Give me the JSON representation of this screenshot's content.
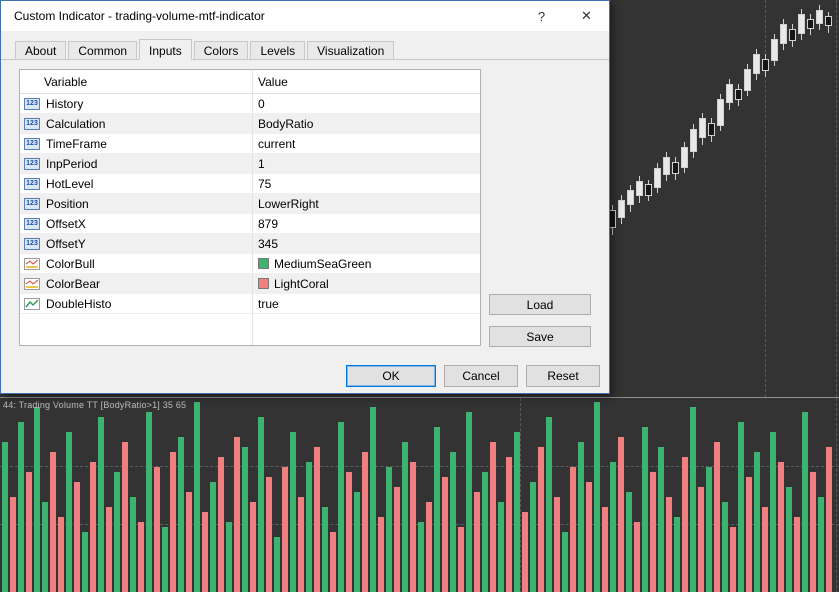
{
  "dialog": {
    "title": "Custom Indicator - trading-volume-mtf-indicator",
    "help_label": "?",
    "close_label": "✕",
    "tabs": [
      {
        "label": "About",
        "active": false
      },
      {
        "label": "Common",
        "active": false
      },
      {
        "label": "Inputs",
        "active": true
      },
      {
        "label": "Colors",
        "active": false
      },
      {
        "label": "Levels",
        "active": false
      },
      {
        "label": "Visualization",
        "active": false
      }
    ],
    "table": {
      "columns": [
        "Variable",
        "Value"
      ],
      "rows": [
        {
          "icon": "numeric-123-icon",
          "variable": "History",
          "value": "0"
        },
        {
          "icon": "numeric-123-icon",
          "variable": "Calculation",
          "value": "BodyRatio"
        },
        {
          "icon": "numeric-123-icon",
          "variable": "TimeFrame",
          "value": "current"
        },
        {
          "icon": "numeric-123-icon",
          "variable": "InpPeriod",
          "value": "1"
        },
        {
          "icon": "numeric-123-icon",
          "variable": "HotLevel",
          "value": "75"
        },
        {
          "icon": "numeric-123-icon",
          "variable": "Position",
          "value": "LowerRight"
        },
        {
          "icon": "numeric-123-icon",
          "variable": "OffsetX",
          "value": "879"
        },
        {
          "icon": "numeric-123-icon",
          "variable": "OffsetY",
          "value": "345"
        },
        {
          "icon": "color-icon",
          "variable": "ColorBull",
          "value": "MediumSeaGreen",
          "swatch": "#3CB371"
        },
        {
          "icon": "color-icon",
          "variable": "ColorBear",
          "value": "LightCoral",
          "swatch": "#F08080"
        },
        {
          "icon": "histogram-icon",
          "variable": "DoubleHisto",
          "value": "true"
        }
      ]
    },
    "buttons": {
      "load": "Load",
      "save": "Save",
      "ok": "OK",
      "cancel": "Cancel",
      "reset": "Reset"
    }
  },
  "chart": {
    "subwindow_label": "44: Trading Volume TT [BodyRatio>1]  35 65",
    "colors": {
      "bull_volume": "#3CB371",
      "bear_volume": "#F08080",
      "background": "#333333"
    }
  },
  "chart_data": {
    "type": "bar",
    "title": "Trading Volume TT [BodyRatio>1]",
    "levels": [
      35,
      65
    ],
    "bars_format": [
      "height_px",
      "color g=MediumSeaGreen p=LightCoral"
    ],
    "bars": [
      [
        150,
        "g"
      ],
      [
        95,
        "p"
      ],
      [
        170,
        "g"
      ],
      [
        120,
        "p"
      ],
      [
        185,
        "g"
      ],
      [
        90,
        "g"
      ],
      [
        140,
        "p"
      ],
      [
        75,
        "p"
      ],
      [
        160,
        "g"
      ],
      [
        110,
        "p"
      ],
      [
        60,
        "g"
      ],
      [
        130,
        "p"
      ],
      [
        175,
        "g"
      ],
      [
        85,
        "p"
      ],
      [
        120,
        "g"
      ],
      [
        150,
        "p"
      ],
      [
        95,
        "g"
      ],
      [
        70,
        "p"
      ],
      [
        180,
        "g"
      ],
      [
        125,
        "p"
      ],
      [
        65,
        "g"
      ],
      [
        140,
        "p"
      ],
      [
        155,
        "g"
      ],
      [
        100,
        "p"
      ],
      [
        190,
        "g"
      ],
      [
        80,
        "p"
      ],
      [
        110,
        "g"
      ],
      [
        135,
        "p"
      ],
      [
        70,
        "g"
      ],
      [
        155,
        "p"
      ],
      [
        145,
        "g"
      ],
      [
        90,
        "p"
      ],
      [
        175,
        "g"
      ],
      [
        115,
        "p"
      ],
      [
        55,
        "g"
      ],
      [
        125,
        "p"
      ],
      [
        160,
        "g"
      ],
      [
        95,
        "p"
      ],
      [
        130,
        "g"
      ],
      [
        145,
        "p"
      ],
      [
        85,
        "g"
      ],
      [
        60,
        "p"
      ],
      [
        170,
        "g"
      ],
      [
        120,
        "p"
      ],
      [
        100,
        "g"
      ],
      [
        140,
        "p"
      ],
      [
        185,
        "g"
      ],
      [
        75,
        "p"
      ],
      [
        125,
        "g"
      ],
      [
        105,
        "p"
      ],
      [
        150,
        "g"
      ],
      [
        130,
        "p"
      ],
      [
        70,
        "g"
      ],
      [
        90,
        "p"
      ],
      [
        165,
        "g"
      ],
      [
        115,
        "p"
      ],
      [
        140,
        "g"
      ],
      [
        65,
        "p"
      ],
      [
        180,
        "g"
      ],
      [
        100,
        "p"
      ],
      [
        120,
        "g"
      ],
      [
        150,
        "p"
      ],
      [
        90,
        "g"
      ],
      [
        135,
        "p"
      ],
      [
        160,
        "g"
      ],
      [
        80,
        "p"
      ],
      [
        110,
        "g"
      ],
      [
        145,
        "p"
      ],
      [
        175,
        "g"
      ],
      [
        95,
        "p"
      ],
      [
        60,
        "g"
      ],
      [
        125,
        "p"
      ],
      [
        150,
        "g"
      ],
      [
        110,
        "p"
      ],
      [
        190,
        "g"
      ],
      [
        85,
        "p"
      ],
      [
        130,
        "g"
      ],
      [
        155,
        "p"
      ],
      [
        100,
        "g"
      ],
      [
        70,
        "p"
      ],
      [
        165,
        "g"
      ],
      [
        120,
        "p"
      ],
      [
        145,
        "g"
      ],
      [
        95,
        "p"
      ],
      [
        75,
        "g"
      ],
      [
        135,
        "p"
      ],
      [
        185,
        "g"
      ],
      [
        105,
        "p"
      ],
      [
        125,
        "g"
      ],
      [
        150,
        "p"
      ],
      [
        90,
        "g"
      ],
      [
        65,
        "p"
      ],
      [
        170,
        "g"
      ],
      [
        115,
        "p"
      ],
      [
        140,
        "g"
      ],
      [
        85,
        "p"
      ],
      [
        160,
        "g"
      ],
      [
        130,
        "p"
      ],
      [
        105,
        "g"
      ],
      [
        75,
        "p"
      ],
      [
        180,
        "g"
      ],
      [
        120,
        "p"
      ],
      [
        95,
        "g"
      ],
      [
        145,
        "p"
      ]
    ],
    "candles_format": [
      "x",
      "wick_top",
      "body_top",
      "body_bottom",
      "wick_bottom",
      "direction u=up d=down"
    ],
    "candles": [
      [
        612,
        205,
        210,
        228,
        235,
        "d"
      ],
      [
        621,
        195,
        200,
        218,
        224,
        "u"
      ],
      [
        630,
        185,
        190,
        205,
        212,
        "u"
      ],
      [
        639,
        176,
        181,
        196,
        203,
        "u"
      ],
      [
        648,
        180,
        184,
        196,
        201,
        "d"
      ],
      [
        657,
        163,
        168,
        188,
        193,
        "u"
      ],
      [
        666,
        152,
        157,
        175,
        181,
        "u"
      ],
      [
        675,
        157,
        162,
        174,
        180,
        "d"
      ],
      [
        684,
        142,
        147,
        168,
        173,
        "u"
      ],
      [
        693,
        124,
        129,
        152,
        158,
        "u"
      ],
      [
        702,
        113,
        118,
        138,
        145,
        "u"
      ],
      [
        711,
        118,
        123,
        136,
        142,
        "d"
      ],
      [
        720,
        94,
        99,
        126,
        131,
        "u"
      ],
      [
        729,
        79,
        84,
        103,
        110,
        "u"
      ],
      [
        738,
        84,
        89,
        100,
        106,
        "d"
      ],
      [
        747,
        64,
        69,
        91,
        96,
        "u"
      ],
      [
        756,
        49,
        54,
        74,
        80,
        "u"
      ],
      [
        765,
        54,
        59,
        71,
        77,
        "d"
      ],
      [
        774,
        34,
        39,
        61,
        66,
        "u"
      ],
      [
        783,
        19,
        24,
        44,
        50,
        "u"
      ],
      [
        792,
        24,
        29,
        41,
        47,
        "d"
      ],
      [
        801,
        9,
        14,
        34,
        40,
        "u"
      ],
      [
        810,
        14,
        19,
        29,
        35,
        "d"
      ],
      [
        819,
        5,
        10,
        24,
        30,
        "u"
      ],
      [
        828,
        12,
        16,
        26,
        33,
        "d"
      ]
    ]
  }
}
